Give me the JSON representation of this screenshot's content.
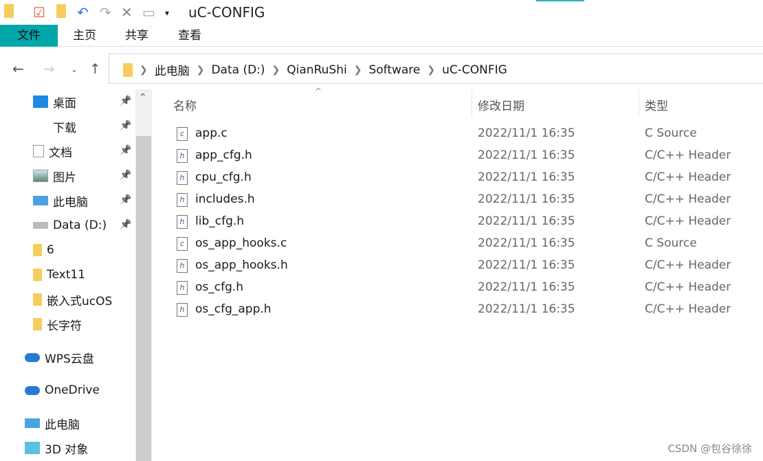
{
  "window": {
    "title": "uC-CONFIG"
  },
  "ribbon": {
    "tabs": [
      "文件",
      "主页",
      "共享",
      "查看"
    ]
  },
  "address": {
    "crumbs": [
      "此电脑",
      "Data (D:)",
      "QianRuShi",
      "Software",
      "uC-CONFIG"
    ]
  },
  "sidebar": {
    "items": [
      {
        "label": "桌面",
        "icon": "desktop-icon",
        "pinned": true
      },
      {
        "label": "下载",
        "icon": "download-icon",
        "pinned": true
      },
      {
        "label": "文档",
        "icon": "document-icon",
        "pinned": true
      },
      {
        "label": "图片",
        "icon": "pictures-icon",
        "pinned": true
      },
      {
        "label": "此电脑",
        "icon": "computer-icon",
        "pinned": true
      },
      {
        "label": "Data (D:)",
        "icon": "drive-icon",
        "pinned": true
      },
      {
        "label": "6",
        "icon": "folder-icon"
      },
      {
        "label": "Text11",
        "icon": "folder-icon"
      },
      {
        "label": "嵌入式ucOS",
        "icon": "folder-icon"
      },
      {
        "label": "长字符",
        "icon": "folder-icon"
      },
      {
        "label": "WPS云盘",
        "icon": "cloud-icon"
      },
      {
        "label": "OneDrive",
        "icon": "cloud-icon"
      },
      {
        "label": "此电脑",
        "icon": "computer-icon"
      },
      {
        "label": "3D 对象",
        "icon": "3d-objects-icon"
      }
    ]
  },
  "columns": {
    "name": "名称",
    "date": "修改日期",
    "type": "类型"
  },
  "files": [
    {
      "name": "app.c",
      "date": "2022/11/1 16:35",
      "type": "C Source",
      "icon": "c"
    },
    {
      "name": "app_cfg.h",
      "date": "2022/11/1 16:35",
      "type": "C/C++ Header",
      "icon": "h"
    },
    {
      "name": "cpu_cfg.h",
      "date": "2022/11/1 16:35",
      "type": "C/C++ Header",
      "icon": "h"
    },
    {
      "name": "includes.h",
      "date": "2022/11/1 16:35",
      "type": "C/C++ Header",
      "icon": "h"
    },
    {
      "name": "lib_cfg.h",
      "date": "2022/11/1 16:35",
      "type": "C/C++ Header",
      "icon": "h"
    },
    {
      "name": "os_app_hooks.c",
      "date": "2022/11/1 16:35",
      "type": "C Source",
      "icon": "c"
    },
    {
      "name": "os_app_hooks.h",
      "date": "2022/11/1 16:35",
      "type": "C/C++ Header",
      "icon": "h"
    },
    {
      "name": "os_cfg.h",
      "date": "2022/11/1 16:35",
      "type": "C/C++ Header",
      "icon": "h"
    },
    {
      "name": "os_cfg_app.h",
      "date": "2022/11/1 16:35",
      "type": "C/C++ Header",
      "icon": "h"
    }
  ],
  "watermark": "CSDN @包谷徐徐",
  "colors": {
    "file_tab": "#00a6aa",
    "folder": "#f4cd5c"
  }
}
